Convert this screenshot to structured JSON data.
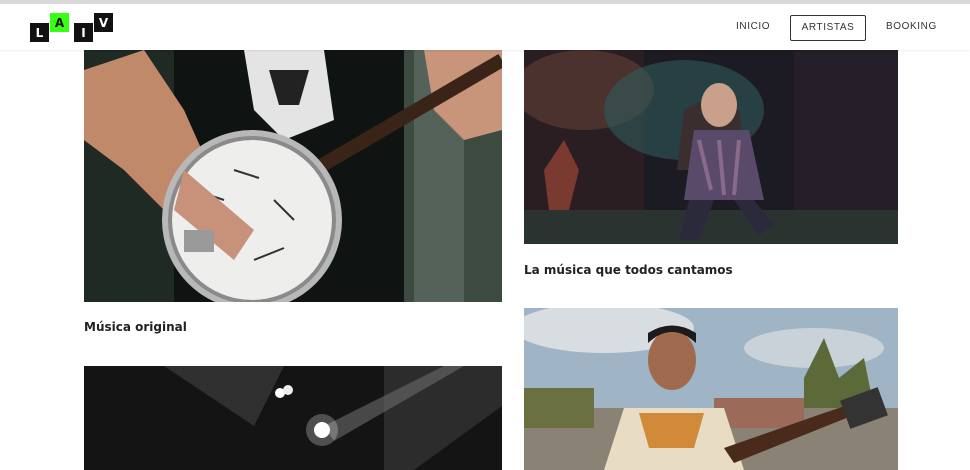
{
  "logo": {
    "letters": [
      "L",
      "A",
      "I",
      "V"
    ],
    "accent": "#39ff14"
  },
  "nav": {
    "items": [
      "INICIO",
      "ARTISTAS",
      "BOOKING"
    ],
    "active": "ARTISTAS"
  },
  "cards": [
    {
      "title": "Música original"
    },
    {
      "title": "La música que todos cantamos"
    },
    {
      "title": ""
    },
    {
      "title": ""
    }
  ]
}
